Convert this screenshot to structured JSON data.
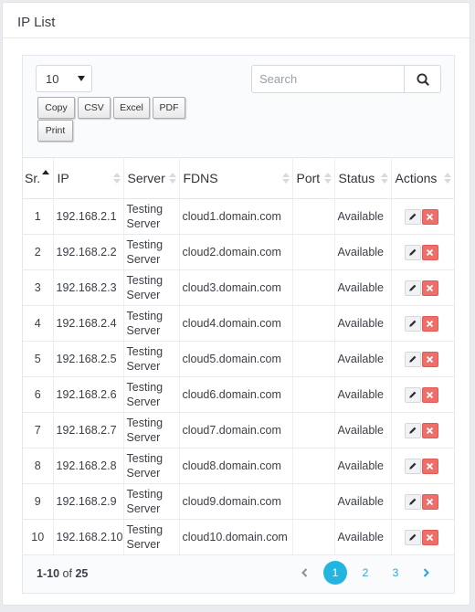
{
  "panel": {
    "title": "IP List"
  },
  "length_select": {
    "value": "10"
  },
  "export_buttons": [
    "Copy",
    "CSV",
    "Excel",
    "PDF",
    "Print"
  ],
  "search": {
    "placeholder": "Search"
  },
  "columns": [
    "Sr.",
    "IP",
    "Server",
    "FDNS",
    "Port",
    "Status",
    "Actions"
  ],
  "rows": [
    {
      "sr": "1",
      "ip": "192.168.2.1",
      "server": "Testing Server",
      "fdns": "cloud1.domain.com",
      "port": "",
      "status": "Available"
    },
    {
      "sr": "2",
      "ip": "192.168.2.2",
      "server": "Testing Server",
      "fdns": "cloud2.domain.com",
      "port": "",
      "status": "Available"
    },
    {
      "sr": "3",
      "ip": "192.168.2.3",
      "server": "Testing Server",
      "fdns": "cloud3.domain.com",
      "port": "",
      "status": "Available"
    },
    {
      "sr": "4",
      "ip": "192.168.2.4",
      "server": "Testing Server",
      "fdns": "cloud4.domain.com",
      "port": "",
      "status": "Available"
    },
    {
      "sr": "5",
      "ip": "192.168.2.5",
      "server": "Testing Server",
      "fdns": "cloud5.domain.com",
      "port": "",
      "status": "Available"
    },
    {
      "sr": "6",
      "ip": "192.168.2.6",
      "server": "Testing Server",
      "fdns": "cloud6.domain.com",
      "port": "",
      "status": "Available"
    },
    {
      "sr": "7",
      "ip": "192.168.2.7",
      "server": "Testing Server",
      "fdns": "cloud7.domain.com",
      "port": "",
      "status": "Available"
    },
    {
      "sr": "8",
      "ip": "192.168.2.8",
      "server": "Testing Server",
      "fdns": "cloud8.domain.com",
      "port": "",
      "status": "Available"
    },
    {
      "sr": "9",
      "ip": "192.168.2.9",
      "server": "Testing Server",
      "fdns": "cloud9.domain.com",
      "port": "",
      "status": "Available"
    },
    {
      "sr": "10",
      "ip": "192.168.2.10",
      "server": "Testing Server",
      "fdns": "cloud10.domain.com",
      "port": "",
      "status": "Available"
    }
  ],
  "info": {
    "range": "1-10",
    "of_label": "of",
    "total": "25"
  },
  "pagination": {
    "pages": [
      "1",
      "2",
      "3"
    ],
    "current": "1"
  },
  "icons": {
    "search": "search-icon",
    "sort": "sort-icon",
    "edit": "pencil-icon",
    "delete": "close-icon",
    "prev": "chevron-left-icon",
    "next": "chevron-right-icon",
    "select": "caret-down-icon"
  },
  "colors": {
    "accent": "#23b5e0",
    "delete": "#ee6e6a",
    "link": "#2aa7d6"
  }
}
